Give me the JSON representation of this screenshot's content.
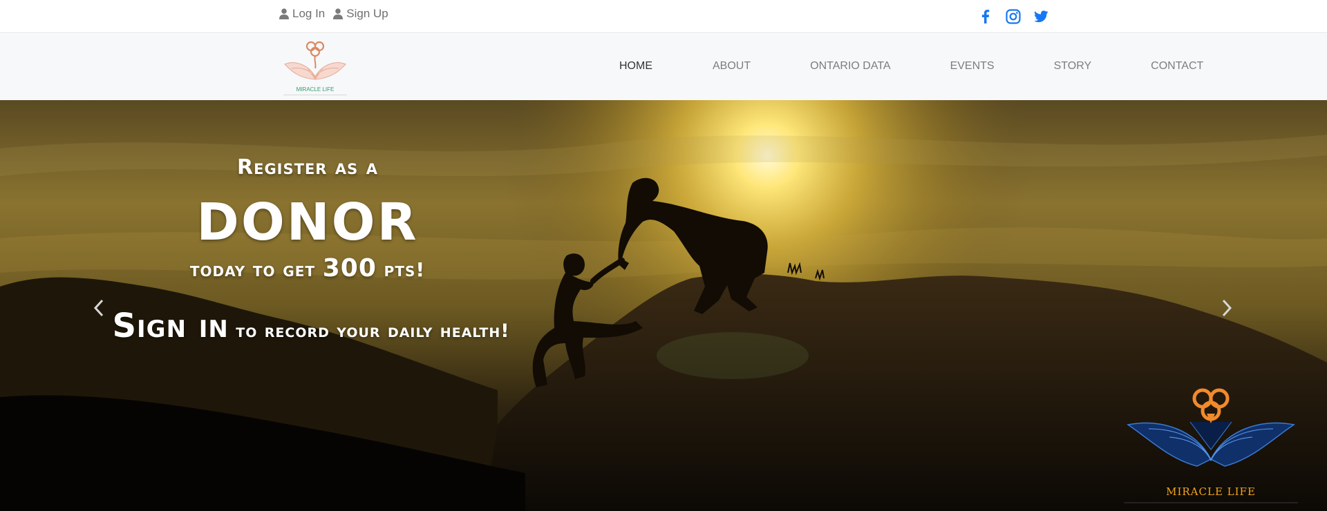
{
  "topbar": {
    "login_label": "Log In",
    "signup_label": "Sign Up",
    "social": [
      "facebook-icon",
      "instagram-icon",
      "twitter-icon"
    ],
    "social_color": "#1877f2"
  },
  "logo": {
    "text": "MIRACLE LIFE"
  },
  "nav": {
    "items": [
      {
        "label": "HOME",
        "active": true
      },
      {
        "label": "ABOUT",
        "active": false
      },
      {
        "label": "ONTARIO DATA",
        "active": false
      },
      {
        "label": "EVENTS",
        "active": false
      },
      {
        "label": "STORY",
        "active": false
      },
      {
        "label": "CONTACT",
        "active": false
      }
    ]
  },
  "hero": {
    "line1": "Register as a",
    "line2": "DONOR",
    "line3_a": "today to get",
    "line3_num": "300",
    "line3_b": "pts!",
    "line4_big": "Sign in",
    "line4_rest": "to record your daily health!",
    "prev_icon": "chevron-left-icon",
    "next_icon": "chevron-right-icon",
    "badge_text": "MIRACLE LIFE"
  }
}
